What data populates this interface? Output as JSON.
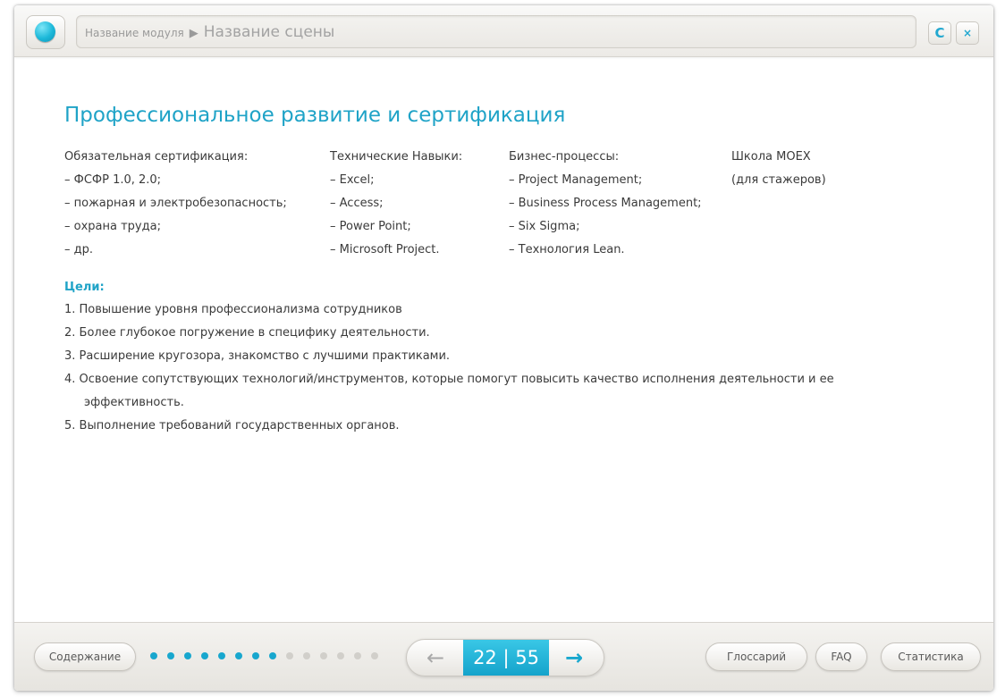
{
  "header": {
    "module_name": "Название модуля",
    "separator": "▶",
    "scene_name": "Название сцены",
    "reload_icon": "C",
    "close_icon": "×"
  },
  "content": {
    "title": "Профессиональное развитие и сертификация",
    "columns": [
      {
        "heading": "Обязательная сертификация:",
        "items": [
          "– ФСФР 1.0, 2.0;",
          "– пожарная и электробезопасность;",
          "– охрана труда;",
          "– др."
        ]
      },
      {
        "heading": "Технические Навыки:",
        "items": [
          "– Excel;",
          "– Access;",
          "– Power Point;",
          "– Microsoft Project."
        ]
      },
      {
        "heading": "Бизнес-процессы:",
        "items": [
          "– Project Management;",
          "– Business Process Management;",
          "– Six Sigma;",
          "– Технология Lean."
        ]
      },
      {
        "heading": "Школа МОЕХ",
        "items": [
          "(для стажеров)"
        ]
      }
    ],
    "goals_title": "Цели:",
    "goals": [
      "1. Повышение уровня профессионализма сотрудников",
      "2. Более глубокое погружение в специфику деятельности.",
      "3. Расширение кругозора, знакомство с лучшими практиками.",
      "4. Освоение сопутствующих технологий/инструментов, которые помогут повысить качество исполнения деятельности и ее",
      "эффективность.",
      "5. Выполнение требований государственных органов."
    ]
  },
  "footer": {
    "contents_label": "Содержание",
    "progress": {
      "total_dots": 14,
      "completed_dots": 8
    },
    "prev_icon": "←",
    "next_icon": "→",
    "page": "22 | 55",
    "glossary_label": "Глоссарий",
    "faq_label": "FAQ",
    "stats_label": "Статистика"
  },
  "colors": {
    "accent": "#1fa3c7",
    "progress_done": "#18a7ce",
    "progress_todo": "#d1cfca"
  }
}
